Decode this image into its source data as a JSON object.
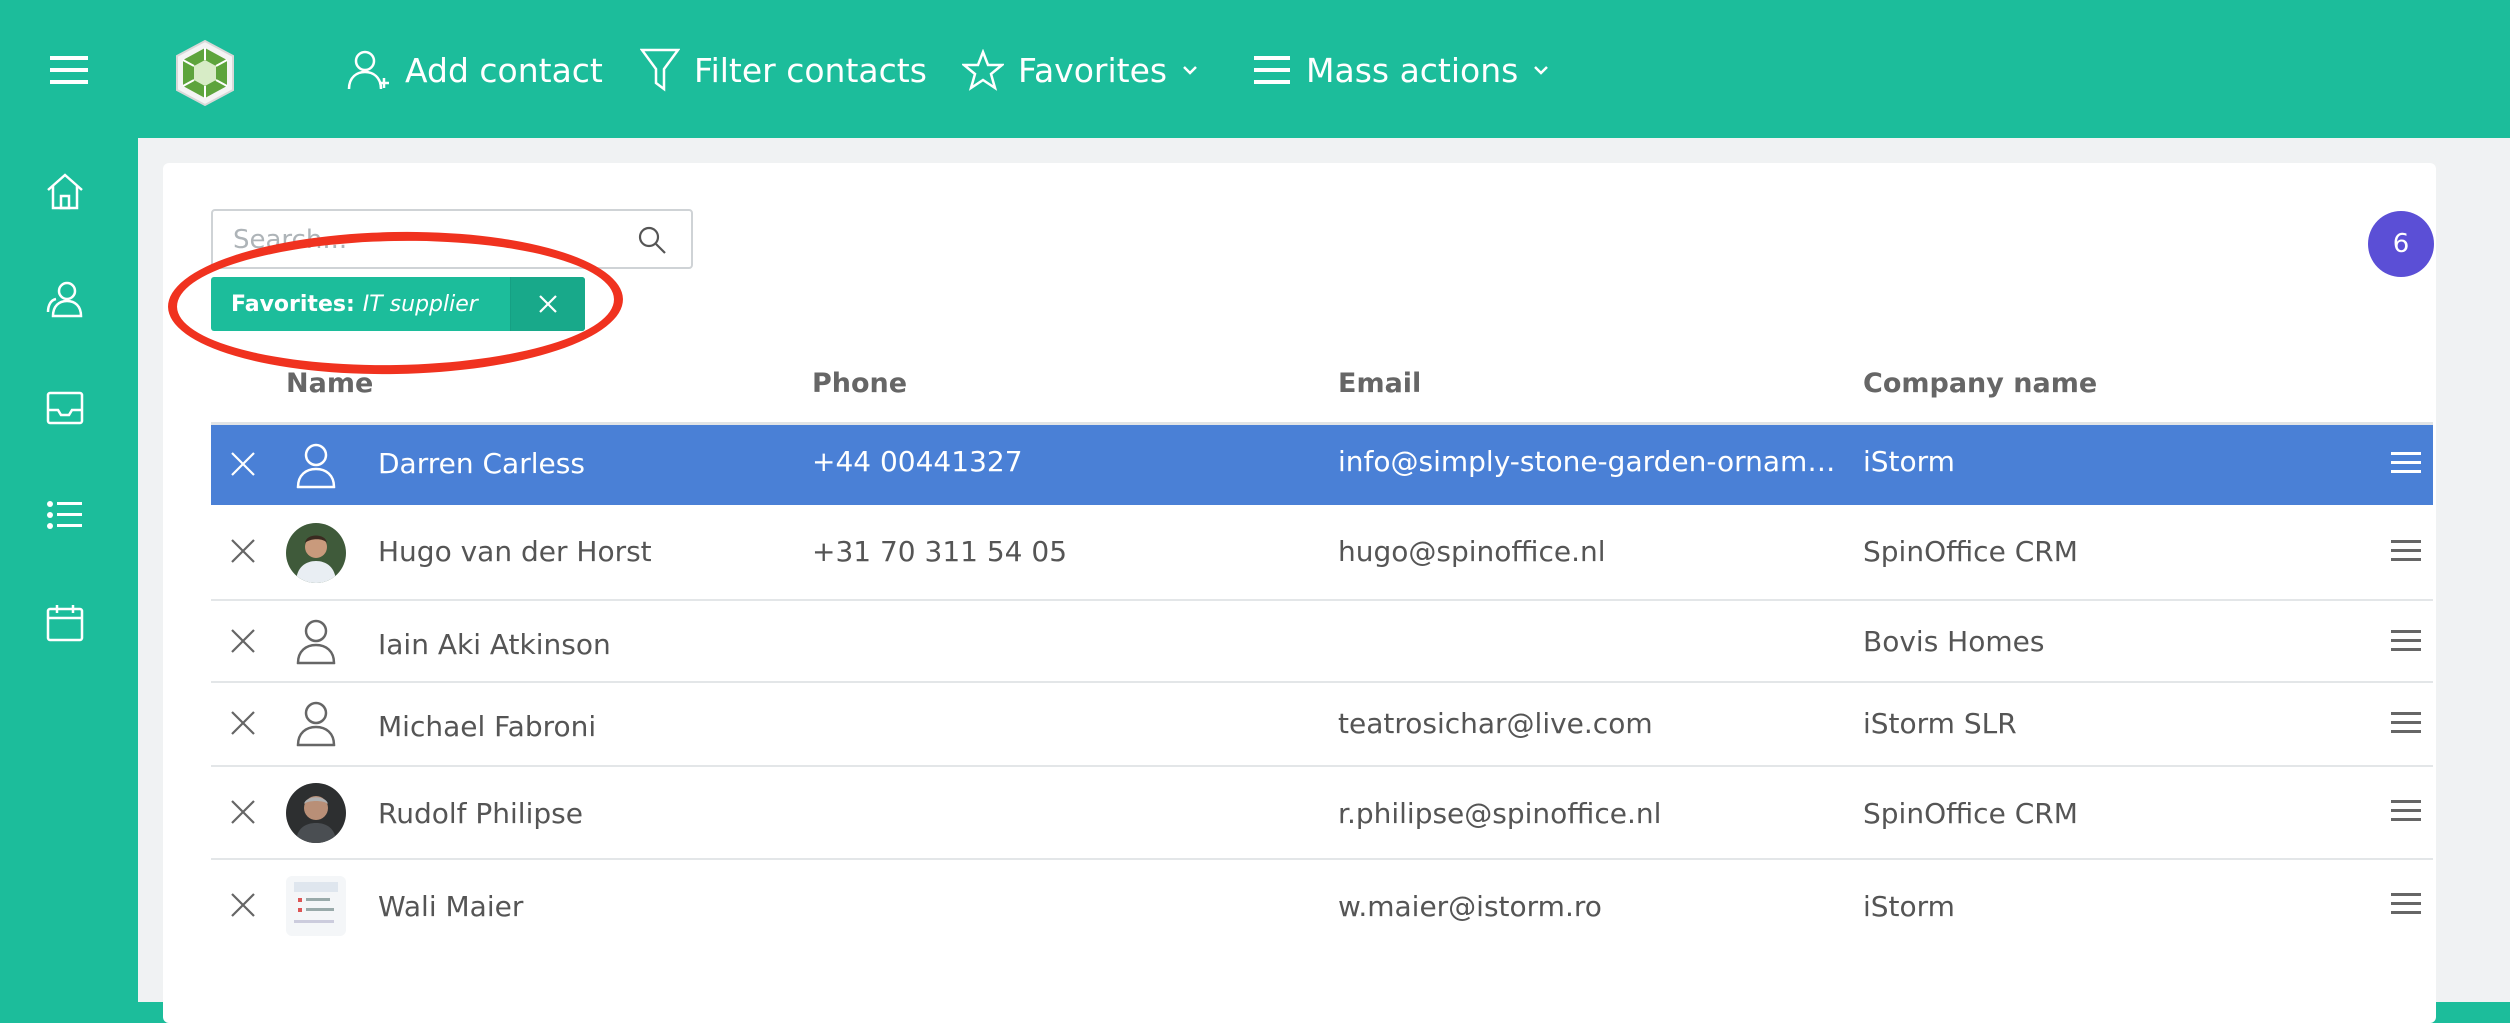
{
  "toolbar": {
    "add_contact": "Add contact",
    "filter_contacts": "Filter contacts",
    "favorites": "Favorites",
    "mass_actions": "Mass actions"
  },
  "search": {
    "placeholder": "Search..."
  },
  "result_count": "6",
  "filter_chip": {
    "label": "Favorites:",
    "value": "IT supplier"
  },
  "table": {
    "headers": {
      "name": "Name",
      "phone": "Phone",
      "email": "Email",
      "company": "Company name"
    },
    "rows": [
      {
        "name": "Darren Carless",
        "phone": "+44 00441327",
        "email": "info@simply-stone-garden-ornaments.co.uk",
        "company": "iStorm",
        "avatar": "person-outline-icon",
        "selected": true
      },
      {
        "name": "Hugo van der Horst",
        "phone": "+31 70 311 54 05",
        "email": "hugo@spinoffice.nl",
        "company": "SpinOffice CRM",
        "avatar": "photo-avatar",
        "selected": false
      },
      {
        "name": "Iain Aki Atkinson",
        "phone": "",
        "email": "",
        "company": "Bovis Homes",
        "avatar": "person-outline-icon",
        "selected": false
      },
      {
        "name": "Michael Fabroni",
        "phone": "",
        "email": "teatrosichar@live.com",
        "company": "iStorm SLR",
        "avatar": "person-outline-icon",
        "selected": false
      },
      {
        "name": "Rudolf Philipse",
        "phone": "",
        "email": "r.philipse@spinoffice.nl",
        "company": "SpinOffice CRM",
        "avatar": "photo-avatar",
        "selected": false
      },
      {
        "name": "Wali Maier",
        "phone": "",
        "email": "w.maier@istorm.ro",
        "company": "iStorm",
        "avatar": "screenshot-avatar",
        "selected": false
      }
    ]
  },
  "colors": {
    "brand": "#1cbd9b",
    "selected_row": "#4a80d6",
    "badge": "#5b4fd6",
    "annotation": "#f0321f"
  }
}
